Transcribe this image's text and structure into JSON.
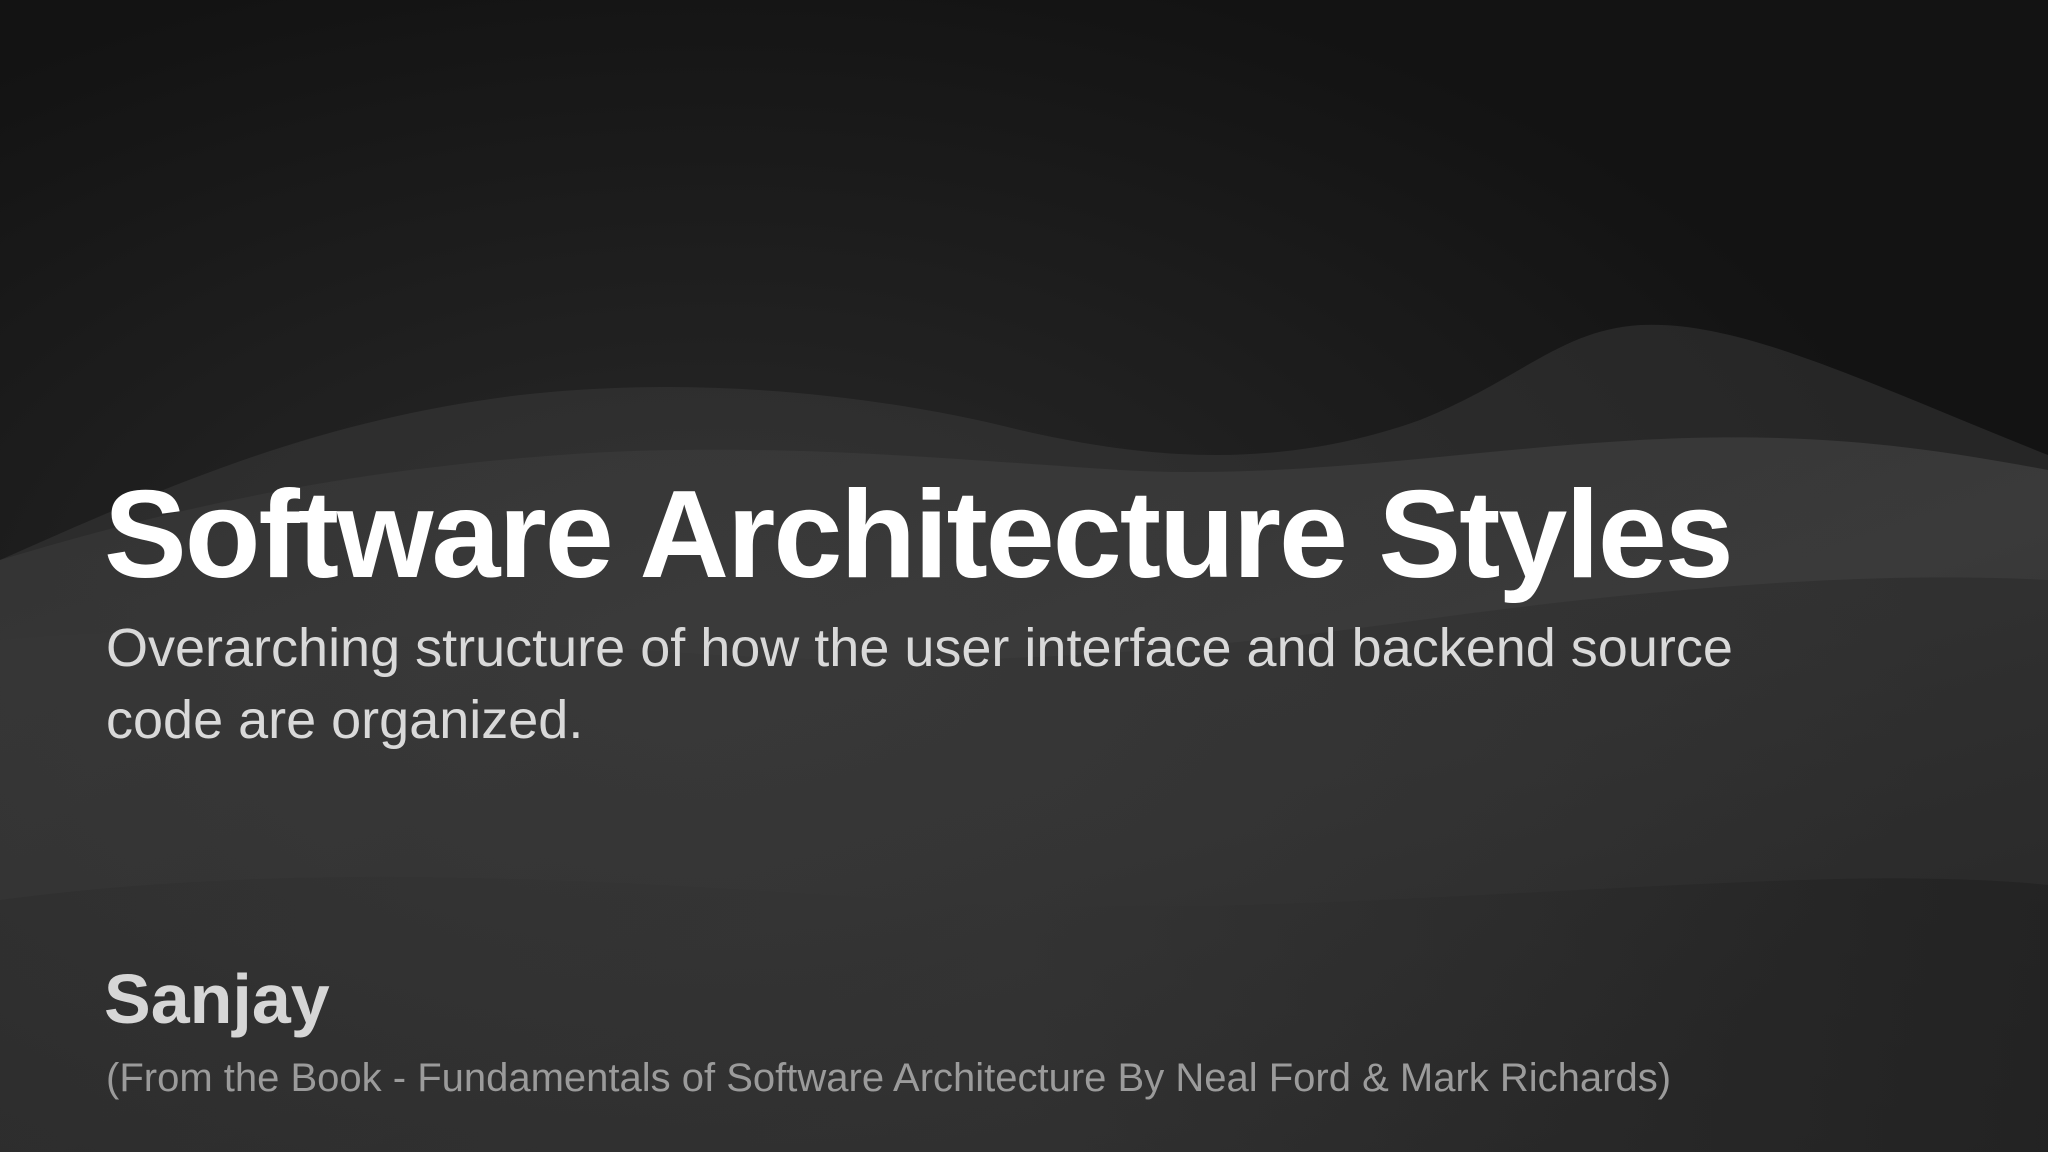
{
  "slide": {
    "title": "Software Architecture Styles",
    "subtitle": "Overarching structure of how the user interface and backend source code are organized.",
    "author": "Sanjay",
    "source": "(From the Book - Fundamentals of Software Architecture By Neal Ford & Mark Richards)"
  },
  "colors": {
    "background_top": "#131313",
    "background_wave": "#2b2b2b",
    "title": "#ffffff",
    "subtitle": "#d9d9d9",
    "author": "#d6d6d6",
    "source": "#9b9b9b"
  }
}
